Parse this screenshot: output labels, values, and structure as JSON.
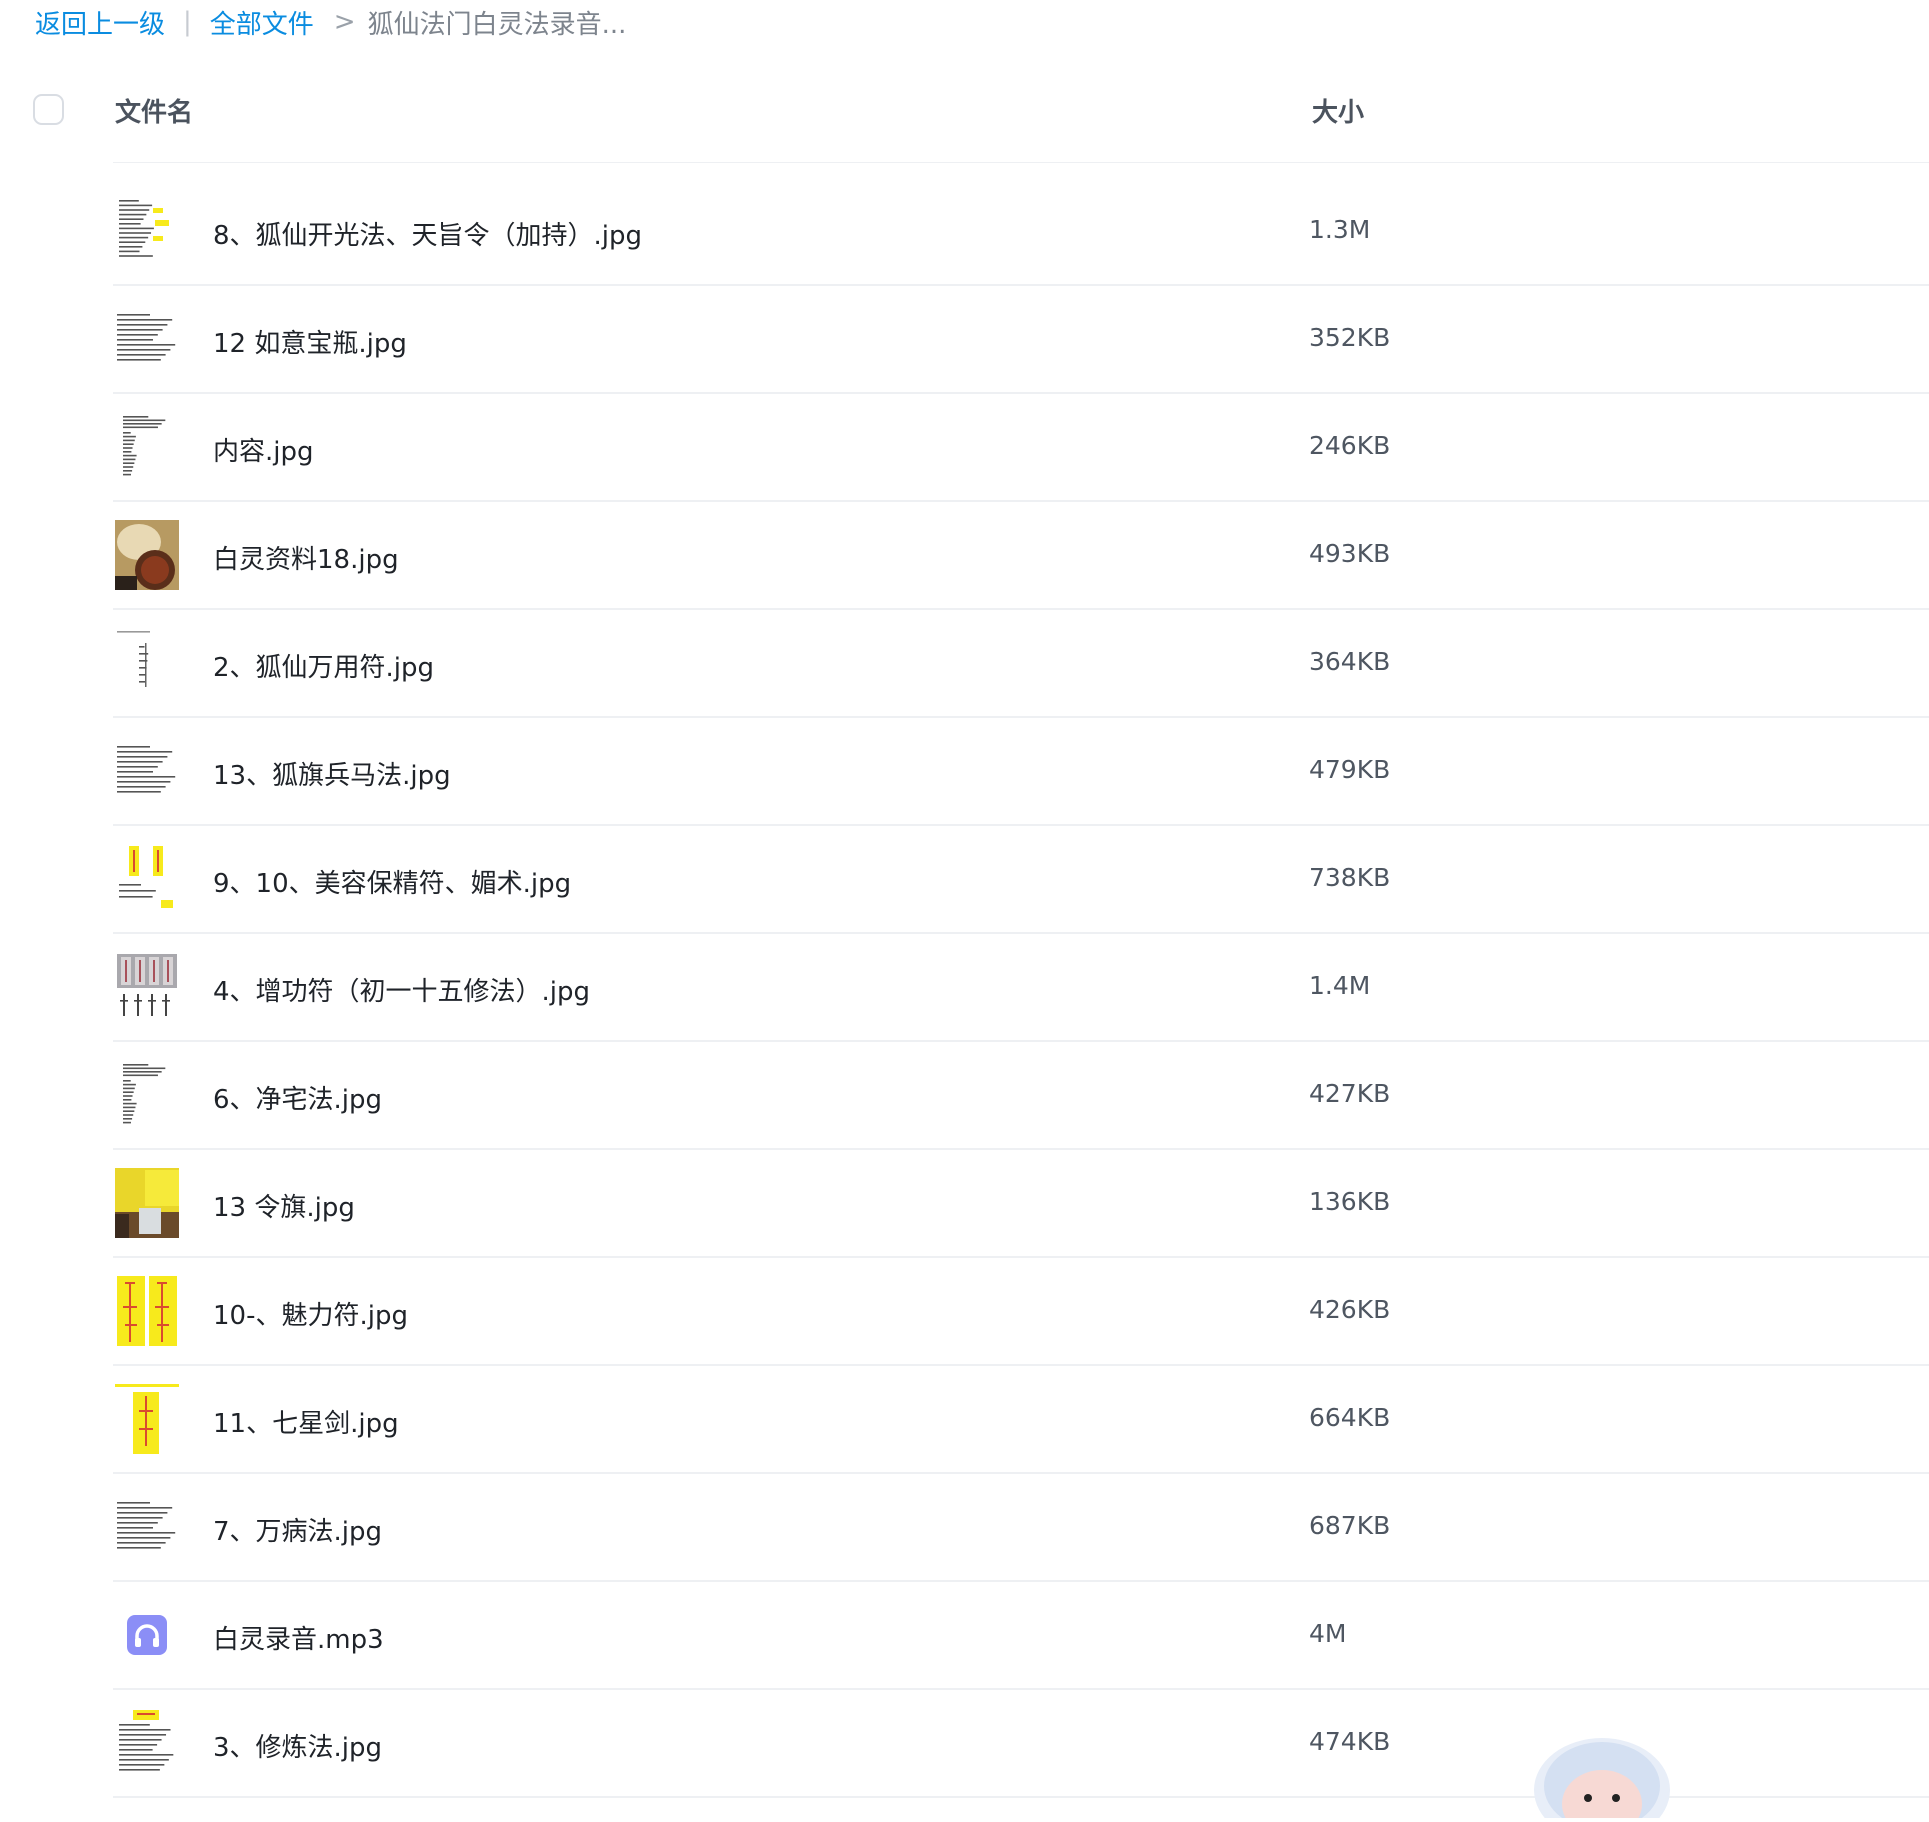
{
  "breadcrumb": {
    "back": "返回上一级",
    "separator": "|",
    "all_files": "全部文件",
    "arrow": ">",
    "current": "狐仙法门白灵法录音..."
  },
  "table_header": {
    "name": "文件名",
    "size": "大小"
  },
  "files": [
    {
      "name": "8、狐仙开光法、天旨令（加持）.jpg",
      "size": "1.3M",
      "thumb": "text-yellow"
    },
    {
      "name": "12 如意宝瓶.jpg",
      "size": "352KB",
      "thumb": "text-dense"
    },
    {
      "name": "内容.jpg",
      "size": "246KB",
      "thumb": "text-column"
    },
    {
      "name": "白灵资料18.jpg",
      "size": "493KB",
      "thumb": "photo-food"
    },
    {
      "name": "2、狐仙万用符.jpg",
      "size": "364KB",
      "thumb": "text-sparse"
    },
    {
      "name": "13、狐旗兵马法.jpg",
      "size": "479KB",
      "thumb": "text-dense"
    },
    {
      "name": "9、10、美容保精符、媚术.jpg",
      "size": "738KB",
      "thumb": "talisman-pair-small"
    },
    {
      "name": "4、增功符（初一十五修法）.jpg",
      "size": "1.4M",
      "thumb": "talisman-grid"
    },
    {
      "name": "6、净宅法.jpg",
      "size": "427KB",
      "thumb": "text-column"
    },
    {
      "name": "13 令旗.jpg",
      "size": "136KB",
      "thumb": "photo-flag"
    },
    {
      "name": "10-、魅力符.jpg",
      "size": "426KB",
      "thumb": "talisman-pair"
    },
    {
      "name": "11、七星剑.jpg",
      "size": "664KB",
      "thumb": "talisman-single"
    },
    {
      "name": "7、万病法.jpg",
      "size": "687KB",
      "thumb": "text-dense"
    },
    {
      "name": "白灵录音.mp3",
      "size": "4M",
      "thumb": "audio-icon"
    },
    {
      "name": "3、修炼法.jpg",
      "size": "474KB",
      "thumb": "text-yellow-header"
    }
  ],
  "colors": {
    "link": "#0a8ce0",
    "audio_icon": "#8b8ef6",
    "talisman_yellow": "#f7ea1c",
    "talisman_red": "#d94b2f"
  }
}
